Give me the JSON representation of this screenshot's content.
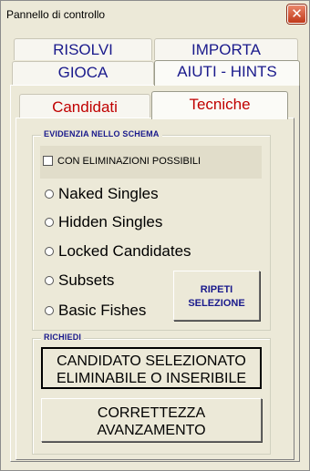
{
  "window": {
    "title": "Pannello di controllo",
    "close_glyph": "✕"
  },
  "tabs": {
    "risolvi": "RISOLVI",
    "importa": "IMPORTA",
    "gioca": "GIOCA",
    "aiuti": "AIUTI - HINTS",
    "selected": "AIUTI - HINTS"
  },
  "inner_tabs": {
    "candidati": "Candidati",
    "tecniche": "Tecniche",
    "selected": "Tecniche"
  },
  "evidenzia": {
    "legend": "EVIDENZIA NELLO SCHEMA",
    "checkbox_label": "CON ELIMINAZIONI POSSIBILI",
    "checkbox_checked": false,
    "options": [
      "Naked Singles",
      "Hidden Singles",
      "Locked Candidates",
      "Subsets",
      "Basic Fishes"
    ],
    "ripeti_line1": "RIPETI",
    "ripeti_line2": "SELEZIONE"
  },
  "richiedi": {
    "legend": "RICHIEDI",
    "btn1_line1": "CANDIDATO SELEZIONATO",
    "btn1_line2": "ELIMINABILE O INSERIBILE",
    "btn2_line1": "CORRETTEZZA",
    "btn2_line2": "AVANZAMENTO"
  },
  "colors": {
    "face": "#ece9d8",
    "tab_text": "#1a1a8c",
    "inner_tab_text": "#c00000",
    "close": "#c1391a"
  }
}
